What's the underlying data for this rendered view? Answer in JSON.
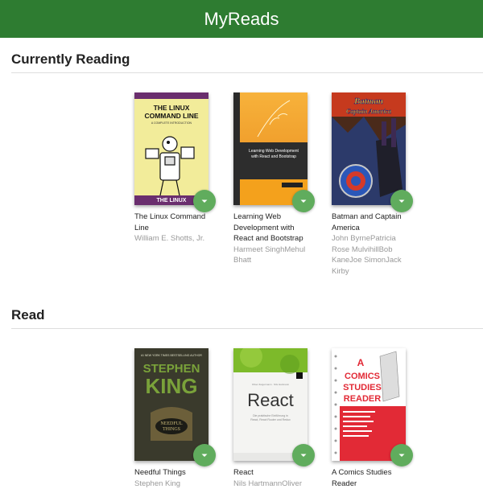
{
  "app": {
    "title": "MyReads"
  },
  "shelves": [
    {
      "title": "Currently Reading",
      "books": [
        {
          "title": "The Linux Command Line",
          "authors": "William E. Shotts, Jr.",
          "cover_text": "THE LINUX COMMAND LINE",
          "cover_subtext": "A COMPLETE INTRODUCTION",
          "cover_bottom": "THE LINUX"
        },
        {
          "title": "Learning Web Development with React and Bootstrap",
          "authors": "Harmeet SinghMehul Bhatt",
          "cover_text": "Learning Web Development with React and Bootstrap"
        },
        {
          "title": "Batman and Captain America",
          "authors": "John ByrnePatricia Rose MulvihillBob KaneJoe SimonJack Kirby",
          "cover_text": "Batman Captain America"
        }
      ]
    },
    {
      "title": "Read",
      "books": [
        {
          "title": "Needful Things",
          "authors": "Stephen King",
          "cover_text": "STEPHEN KING",
          "cover_subtext": "NEEDFUL THINGS"
        },
        {
          "title": "React",
          "authors": "Nils HartmannOliver",
          "cover_text": "React"
        },
        {
          "title": "A Comics Studies Reader",
          "authors": "",
          "cover_text": "A COMICS STUDIES READER"
        }
      ]
    }
  ],
  "icons": {
    "shelf_changer": "caret-down-icon"
  },
  "colors": {
    "header": "#2e7c31",
    "changer": "#60ac5d",
    "author_text": "#999999"
  }
}
